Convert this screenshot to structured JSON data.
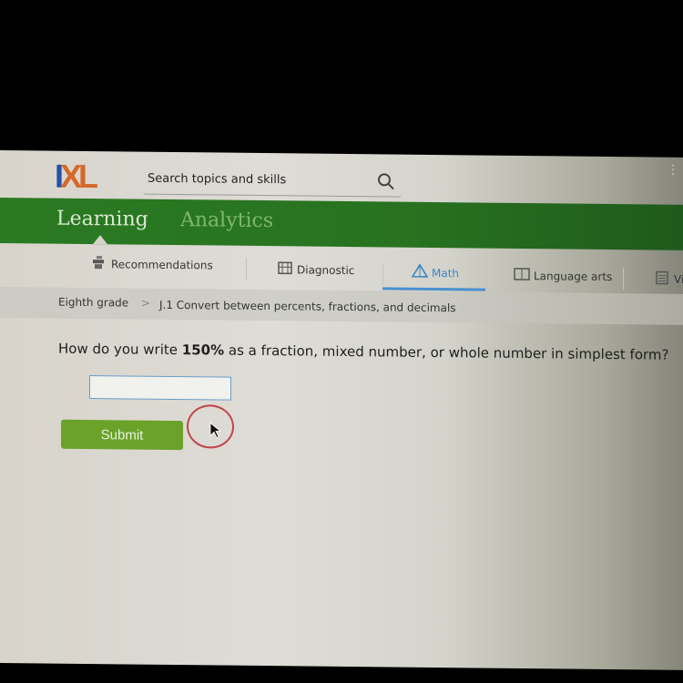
{
  "header": {
    "logo": {
      "i": "I",
      "x": "X",
      "l": "L"
    },
    "search_placeholder": "Search topics and skills",
    "search_icon": "search-icon",
    "menu_icon": "vertical-dots-icon"
  },
  "main_tabs": [
    {
      "label": "Learning",
      "active": true
    },
    {
      "label": "Analytics",
      "active": false
    }
  ],
  "sub_tabs": [
    {
      "label": "Recommendations",
      "icon": "recommendations-icon"
    },
    {
      "label": "Diagnostic",
      "icon": "diagnostic-icon"
    },
    {
      "label": "Math",
      "icon": "math-pyramid-icon",
      "active": true
    },
    {
      "label": "Language arts",
      "icon": "book-icon"
    },
    {
      "label": "Vir",
      "icon": "clipboard-icon"
    }
  ],
  "breadcrumb": {
    "grade": "Eighth grade",
    "separator": ">",
    "skill": "J.1 Convert between percents, fractions, and decimals"
  },
  "question": {
    "prefix": "How do you write ",
    "value": "150%",
    "suffix": " as a fraction, mixed number, or whole number in simplest form?"
  },
  "answer": {
    "value": "",
    "placeholder": ""
  },
  "submit_label": "Submit",
  "colors": {
    "brand_green": "#2a7a22",
    "submit_green": "#6aa22a",
    "math_accent": "#4a8fd0",
    "logo_blue": "#2450a8",
    "logo_orange": "#d4692a"
  }
}
